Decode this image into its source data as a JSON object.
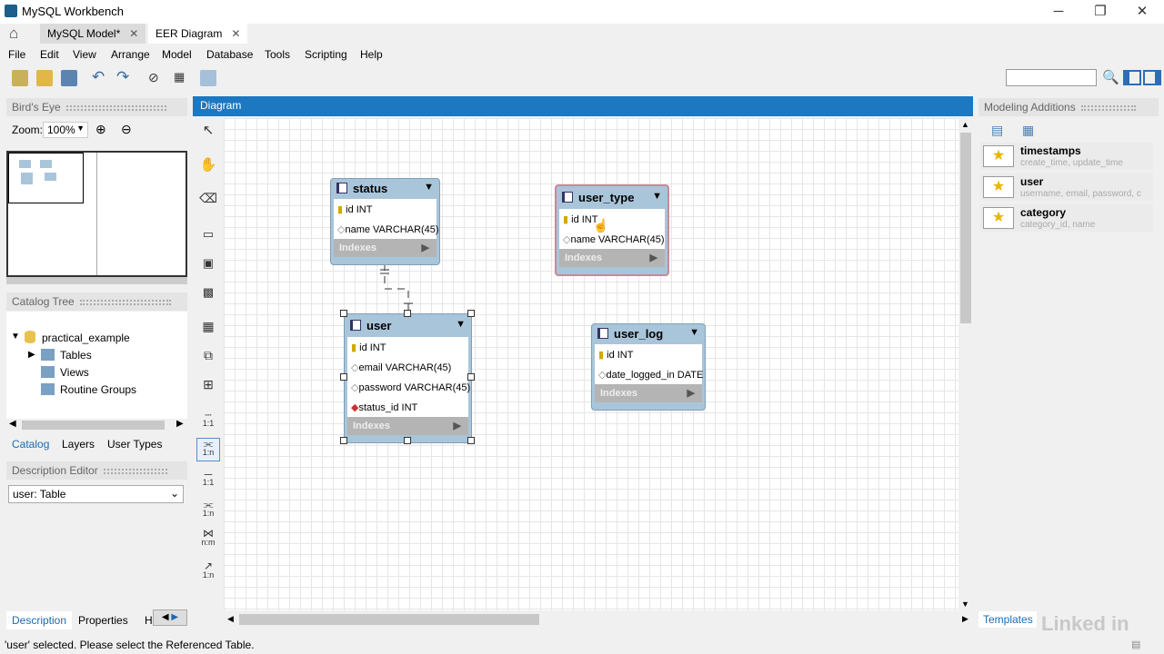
{
  "window": {
    "title": "MySQL Workbench",
    "minimize": "─",
    "maximize": "❐",
    "close": "✕"
  },
  "tabs": [
    {
      "label": "MySQL Model*"
    },
    {
      "label": "EER Diagram"
    }
  ],
  "menu": [
    "File",
    "Edit",
    "View",
    "Arrange",
    "Model",
    "Database",
    "Tools",
    "Scripting",
    "Help"
  ],
  "birdseye": {
    "title": "Bird's Eye",
    "zoom_label": "Zoom:",
    "zoom_value": "100%"
  },
  "catalog": {
    "title": "Catalog Tree",
    "schema": "practical_example",
    "items": [
      "Tables",
      "Views",
      "Routine Groups"
    ]
  },
  "left_tabs": [
    "Catalog",
    "Layers",
    "User Types"
  ],
  "description": {
    "title": "Description Editor",
    "selected": "user: Table"
  },
  "bottom_tabs": [
    "Description",
    "Properties",
    "H"
  ],
  "diagram": {
    "title": "Diagram"
  },
  "entities": {
    "status": {
      "name": "status",
      "cols": [
        "id INT",
        "name VARCHAR(45)"
      ],
      "indexes": "Indexes"
    },
    "user_type": {
      "name": "user_type",
      "cols": [
        "id INT",
        "name VARCHAR(45)"
      ],
      "indexes": "Indexes"
    },
    "user": {
      "name": "user",
      "cols": [
        "id INT",
        "email VARCHAR(45)",
        "password VARCHAR(45)",
        "status_id INT"
      ],
      "indexes": "Indexes"
    },
    "user_log": {
      "name": "user_log",
      "cols": [
        "id INT",
        "date_logged_in DATE"
      ],
      "indexes": "Indexes"
    }
  },
  "relations": [
    "1:1",
    "1:n",
    "1:1",
    "1:n",
    "n:m",
    "1:n"
  ],
  "modeling_additions": {
    "title": "Modeling Additions",
    "items": [
      {
        "name": "timestamps",
        "sub": "create_time, update_time"
      },
      {
        "name": "user",
        "sub": "username, email, password,  c"
      },
      {
        "name": "category",
        "sub": "category_id, name"
      }
    ],
    "templates_tab": "Templates"
  },
  "status_bar": "'user' selected. Please select the Referenced Table.",
  "watermark": "Linked in"
}
